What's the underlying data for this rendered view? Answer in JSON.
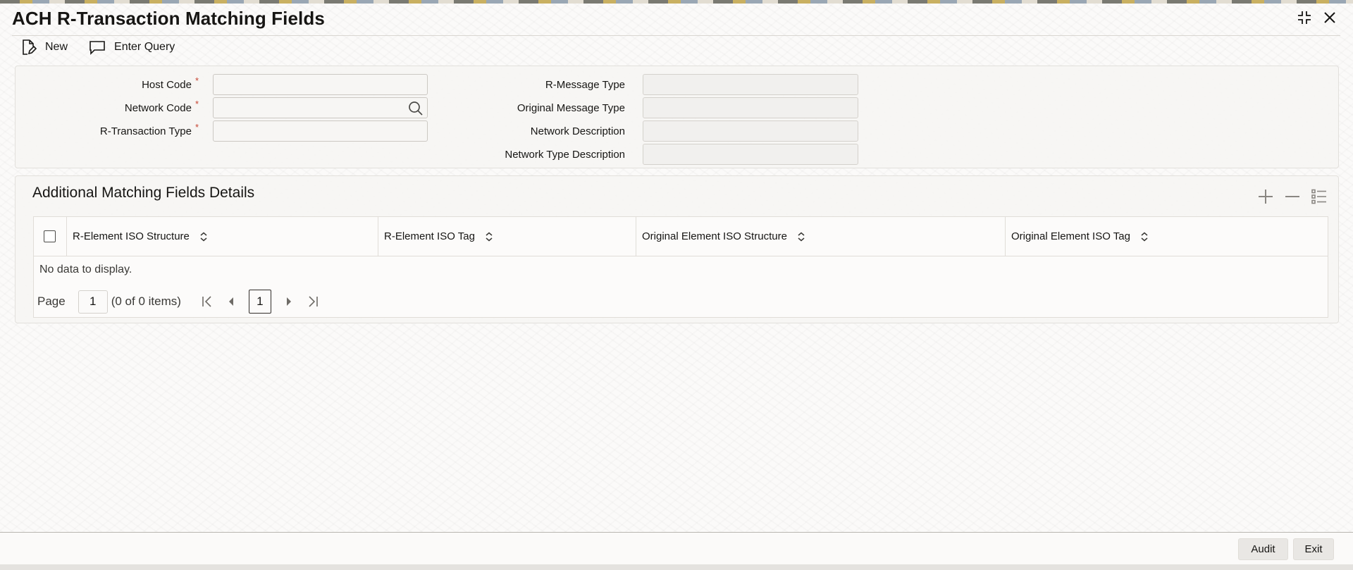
{
  "window": {
    "title": "ACH R-Transaction Matching Fields",
    "controls": [
      {
        "name": "maximize",
        "icon": "maximize-icon"
      },
      {
        "name": "close",
        "icon": "close-icon"
      }
    ]
  },
  "toolbar": {
    "new_label": "New",
    "new_icon": "new-document-icon",
    "enter_query_label": "Enter Query",
    "enter_query_icon": "speech-bubble-icon"
  },
  "form": {
    "required_mark": "*",
    "host_code": {
      "label": "Host Code",
      "value": ""
    },
    "network_code": {
      "label": "Network Code",
      "value": "",
      "icon": "search-icon"
    },
    "r_transaction_type": {
      "label": "R-Transaction Type",
      "value": ""
    },
    "r_message_type": {
      "label": "R-Message Type",
      "value": ""
    },
    "original_message_type": {
      "label": "Original Message Type",
      "value": ""
    },
    "network_description": {
      "label": "Network Description",
      "value": ""
    },
    "network_type_description": {
      "label": "Network Type Description",
      "value": ""
    }
  },
  "grid": {
    "title": "Additional Matching Fields Details",
    "actions": [
      {
        "name": "add-row",
        "icon": "plus-icon"
      },
      {
        "name": "delete-row",
        "icon": "minus-icon"
      },
      {
        "name": "single-record-view",
        "icon": "list-icon"
      }
    ],
    "columns": [
      "R-Element ISO Structure",
      "R-Element ISO Tag",
      "Original Element ISO Structure",
      "Original Element ISO Tag"
    ],
    "rows": [],
    "empty_text": "No data to display.",
    "pager": {
      "page_label": "Page",
      "page_value": "1",
      "items_text": "(0 of 0 items)",
      "current_page": "1"
    }
  },
  "footer": {
    "audit_label": "Audit",
    "exit_label": "Exit"
  },
  "colors": {
    "required": "#c74634",
    "text": "#161513",
    "panel_background": "#f6f5f3",
    "field_border": "#cbc8c3"
  }
}
